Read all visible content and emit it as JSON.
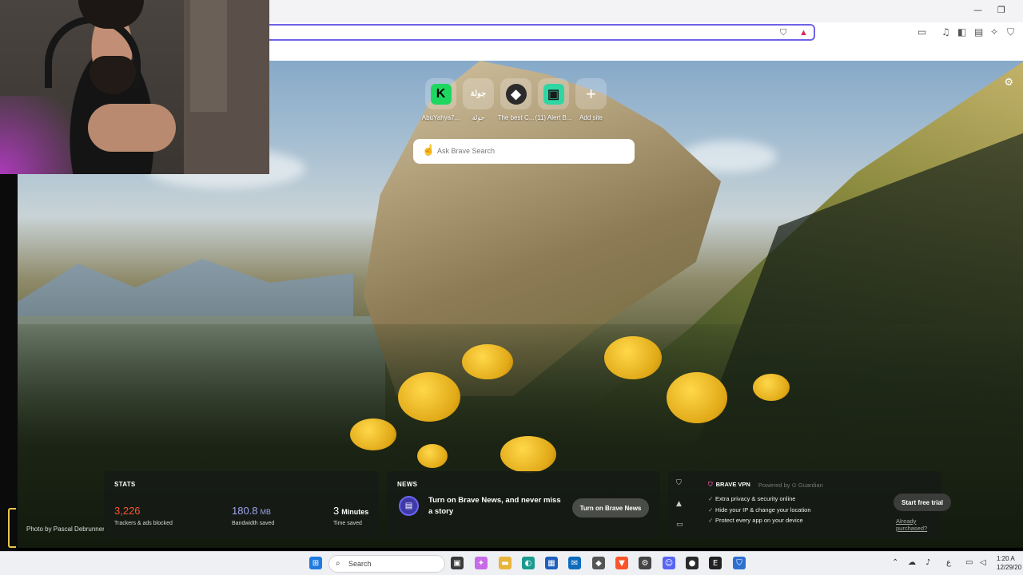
{
  "window": {
    "minimize": "—",
    "maximize": "❐"
  },
  "new_tab": {
    "top_sites": [
      {
        "label": "AbuYahya7...",
        "logo": "K",
        "logo_bg": "#1ed760",
        "logo_fg": "#000000"
      },
      {
        "label": "جولة",
        "logo": "جولة",
        "logo_bg": "transparent",
        "logo_fg": "#ffffff"
      },
      {
        "label": "The best C...",
        "logo": "◆",
        "logo_bg": "#2b2b2b",
        "logo_fg": "#ffffff"
      },
      {
        "label": "(11) Alert B...",
        "logo": "▣",
        "logo_bg": "#2fd6a3",
        "logo_fg": "#1a1a1a"
      },
      {
        "label": "Add site",
        "logo": "+",
        "logo_bg": "transparent",
        "logo_fg": "#ffffff"
      }
    ],
    "search_placeholder": "Ask Brave Search",
    "photo_credit": "Photo by Pascal Debrunner",
    "stats": {
      "title": "STATS",
      "trackers_value": "3,226",
      "trackers_label": "Trackers & ads blocked",
      "bandwidth_value": "180.8",
      "bandwidth_unit": "MB",
      "bandwidth_label": "Bandwidth saved",
      "time_value": "3",
      "time_unit": "Minutes",
      "time_label": "Time saved",
      "accent_trackers": "#fb542b",
      "accent_bandwidth": "#a0a5eb"
    },
    "news": {
      "title": "NEWS",
      "text": "Turn on Brave News, and never miss a story",
      "button": "Turn on Brave News"
    },
    "vpn": {
      "title": "BRAVE VPN",
      "powered": "Powered by ⊙ Guardian",
      "features": [
        "Extra privacy & security online",
        "Hide your IP & change your location",
        "Protect every app on your device"
      ],
      "cta": "Start free trial",
      "link": "Already purchased?"
    }
  },
  "taskbar": {
    "search_label": "Search",
    "time": "1:20 A",
    "date": "12/29/20",
    "lang": "ع"
  }
}
